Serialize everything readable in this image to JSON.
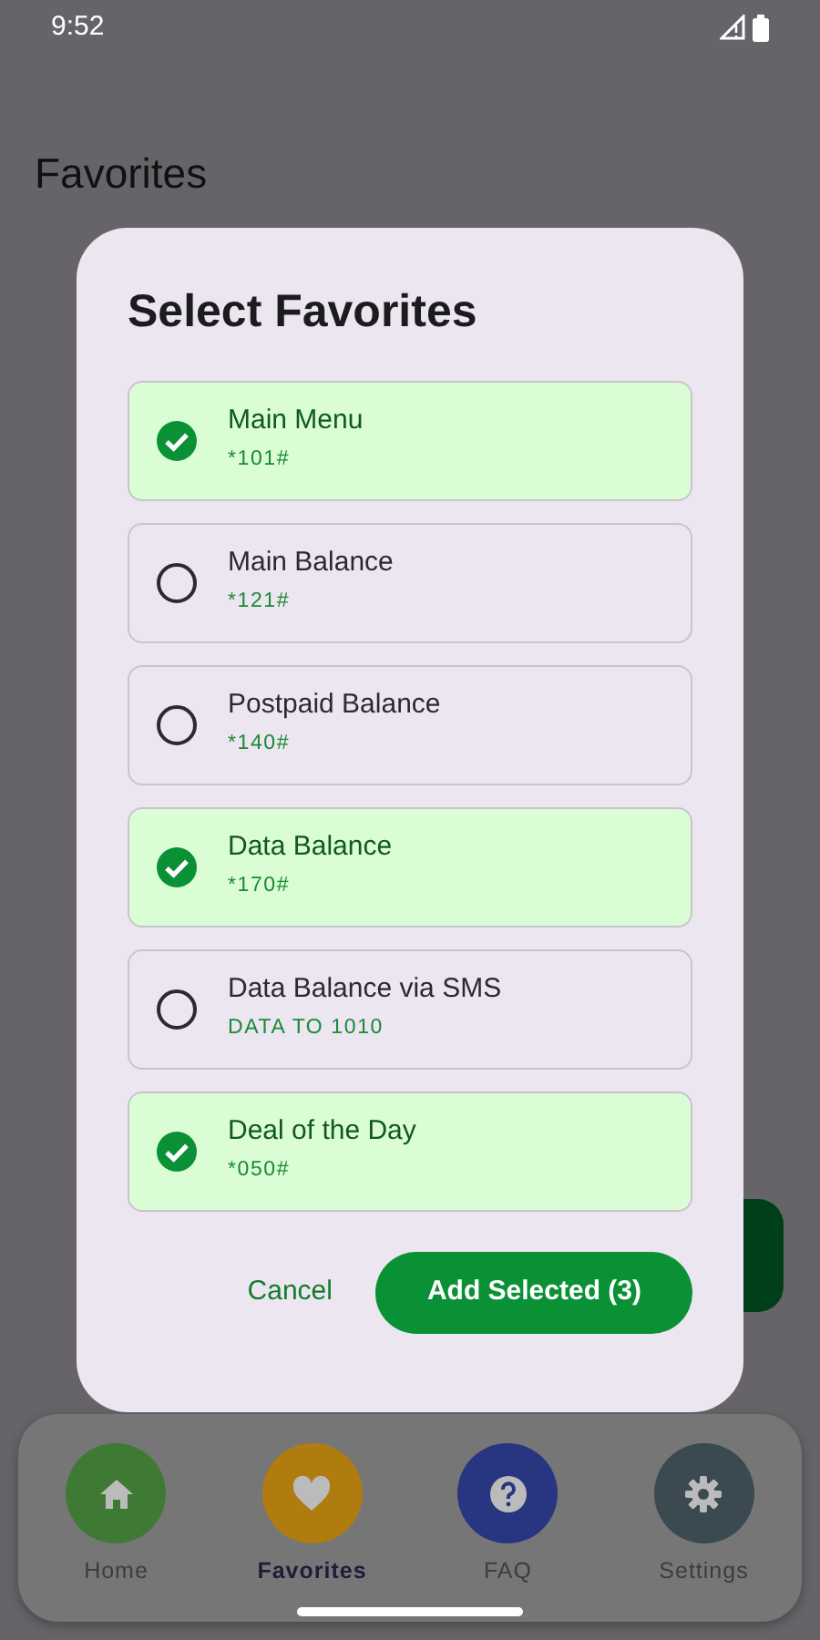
{
  "status_bar": {
    "time": "9:52"
  },
  "page": {
    "title": "Favorites"
  },
  "dialog": {
    "title": "Select Favorites",
    "items": [
      {
        "name": "Main Menu",
        "code": "*101#",
        "selected": true
      },
      {
        "name": "Main Balance",
        "code": "*121#",
        "selected": false
      },
      {
        "name": "Postpaid Balance",
        "code": "*140#",
        "selected": false
      },
      {
        "name": "Data Balance",
        "code": "*170#",
        "selected": true
      },
      {
        "name": "Data Balance via SMS",
        "code": "DATA TO 1010",
        "selected": false
      },
      {
        "name": "Deal of the Day",
        "code": "*050#",
        "selected": true
      }
    ],
    "buttons": [
      {
        "label": "Cancel",
        "kind": "text"
      },
      {
        "label": "Add Selected (3)",
        "kind": "filled"
      }
    ]
  },
  "bottom_nav": [
    {
      "label": "Home",
      "kind": "home",
      "color": "#3f7a35",
      "selected": false
    },
    {
      "label": "Favorites",
      "kind": "heart",
      "color": "#b07c10",
      "selected": true
    },
    {
      "label": "FAQ",
      "kind": "question",
      "color": "#283580",
      "selected": false
    },
    {
      "label": "Settings",
      "kind": "gear",
      "color": "#3b4a50",
      "selected": false
    }
  ]
}
